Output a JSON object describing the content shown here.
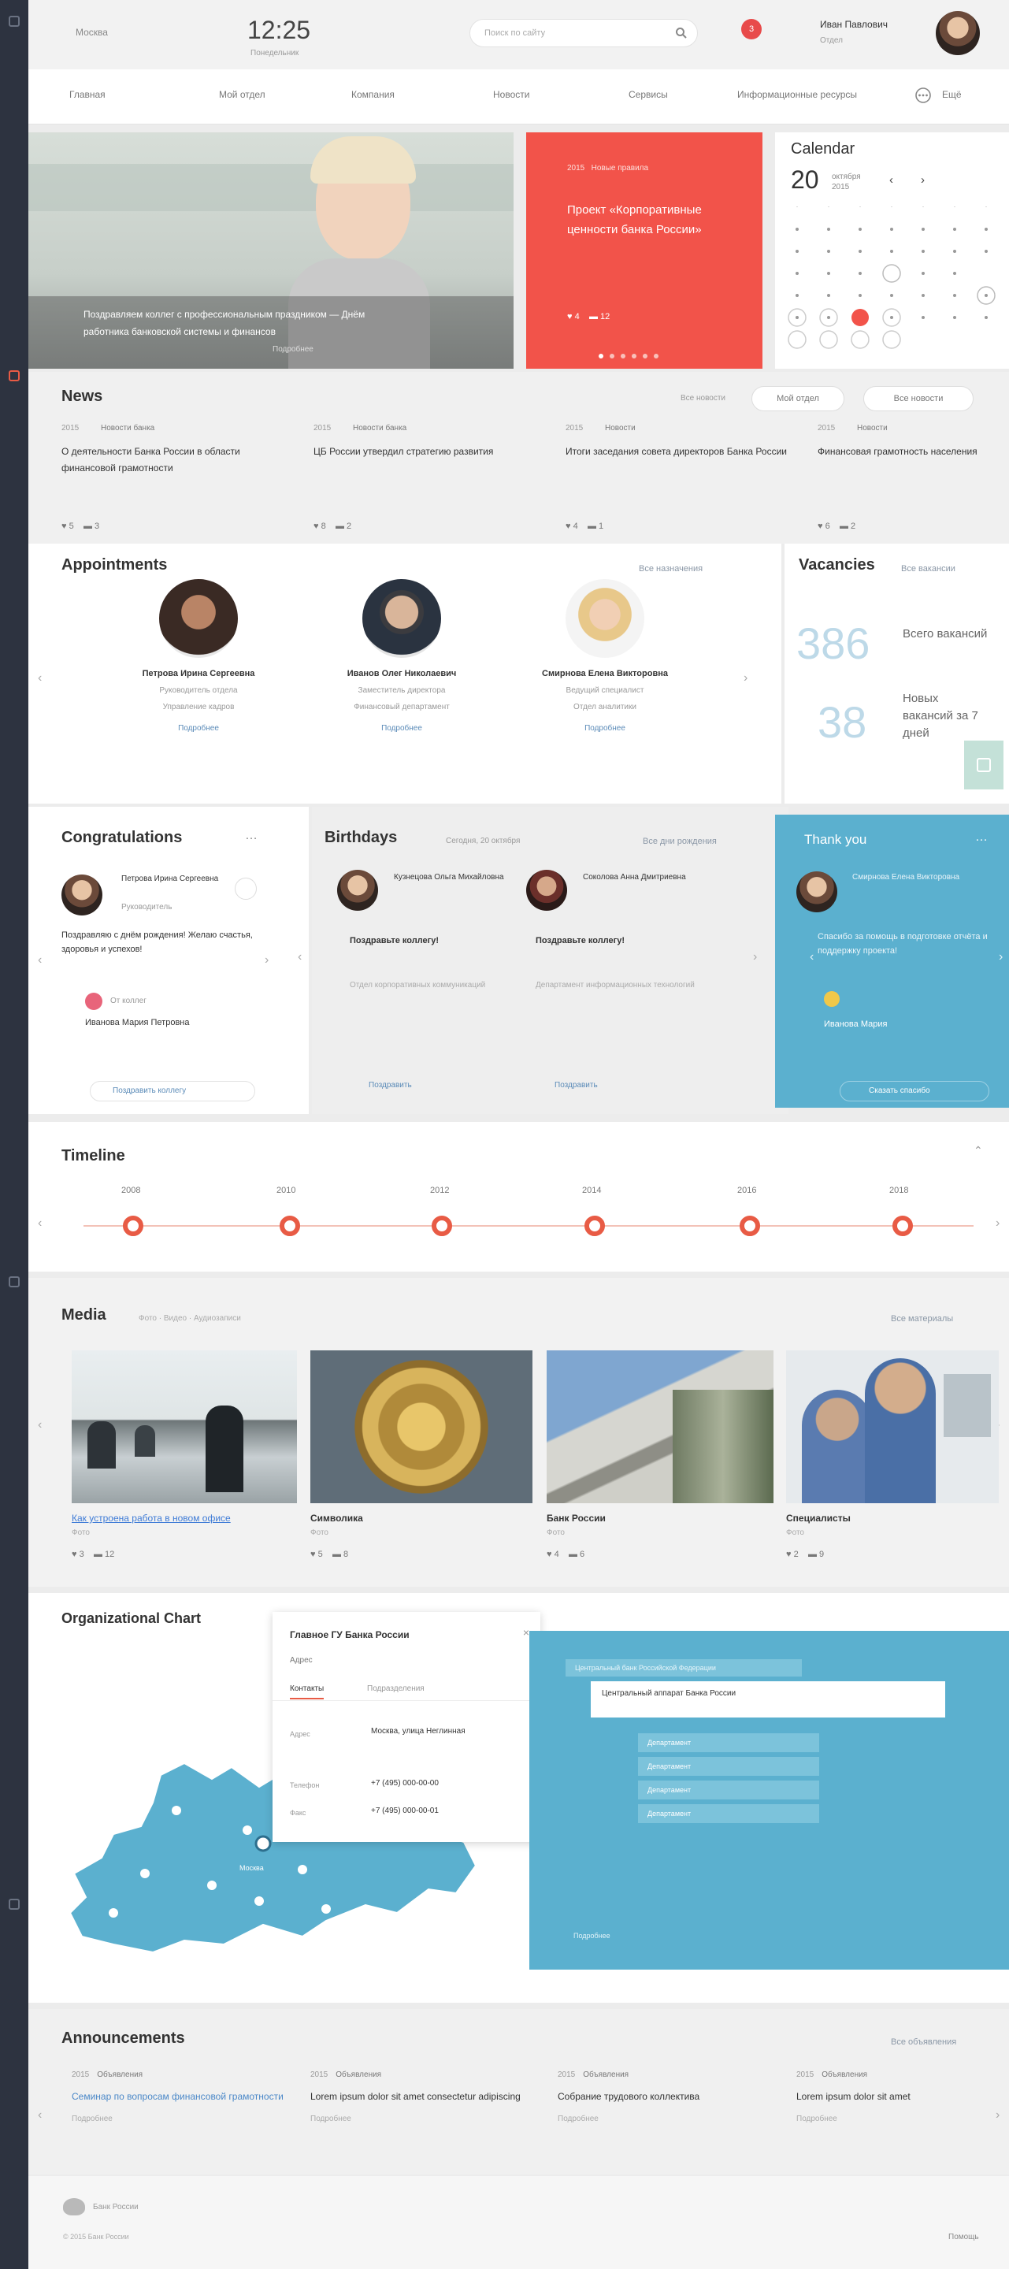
{
  "header": {
    "left_label": "Москва",
    "time": "12:25",
    "date": "Понедельник",
    "search_placeholder": "Поиск по сайту",
    "notif_count": "3",
    "user_name": "Иван Павлович",
    "user_role": "Отдел"
  },
  "nav": {
    "items": [
      "Главная",
      "Мой отдел",
      "Компания",
      "Новости",
      "Сервисы",
      "Информационные ресурсы"
    ],
    "more": "Ещё"
  },
  "hero": {
    "caption_line1": "Поздравляем коллег с профессиональным праздником — Днём",
    "caption_line2": "работника банковской системы и финансов",
    "caption_line3": "Подробнее"
  },
  "promo": {
    "meta_a": "2015",
    "meta_b": "Новые правила",
    "title": "Проект «Корпоративные ценности банка России»",
    "likes": "4",
    "comments": "12"
  },
  "calendar": {
    "title": "Calendar",
    "day": "20",
    "month": "октября 2015"
  },
  "news": {
    "title": "News",
    "filter_label": "Все новости",
    "btn1": "Мой отдел",
    "btn2": "Все новости",
    "items": [
      {
        "date": "2015",
        "tag": "Новости банка",
        "text": "О деятельности Банка России в области финансовой грамотности",
        "likes": "5",
        "comments": "3"
      },
      {
        "date": "2015",
        "tag": "Новости банка",
        "text": "ЦБ России утвердил стратегию развития",
        "likes": "8",
        "comments": "2"
      },
      {
        "date": "2015",
        "tag": "Новости",
        "text": "Итоги заседания совета директоров Банка России",
        "likes": "4",
        "comments": "1"
      },
      {
        "date": "2015",
        "tag": "Новости",
        "text": "Финансовая грамотность населения",
        "likes": "6",
        "comments": "2"
      }
    ]
  },
  "appointments": {
    "title": "Appointments",
    "all_link": "Все назначения",
    "people": [
      {
        "name": "Петрова Ирина Сергеевна",
        "role": "Руководитель отдела",
        "dept": "Управление кадров",
        "link": "Подробнее"
      },
      {
        "name": "Иванов Олег Николаевич",
        "role": "Заместитель директора",
        "dept": "Финансовый департамент",
        "link": "Подробнее"
      },
      {
        "name": "Смирнова Елена Викторовна",
        "role": "Ведущий специалист",
        "dept": "Отдел аналитики",
        "link": "Подробнее"
      }
    ]
  },
  "vacancies": {
    "title": "Vacancies",
    "all_link": "Все вакансии",
    "total_num": "386",
    "total_label": "Всего вакансий",
    "new_num": "38",
    "new_label": "Новых вакансий за 7 дней"
  },
  "congrats": {
    "title": "Congratulations",
    "name": "Петрова Ирина Сергеевна",
    "role": "Руководитель",
    "text": "Поздравляю с днём рождения! Желаю счастья, здоровья и успехов!",
    "from_label": "От коллег",
    "from_name": "Иванова Мария Петровна",
    "link": "Поздравить коллегу"
  },
  "birthdays": {
    "title": "Birthdays",
    "date_label": "Сегодня, 20 октября",
    "all_link": "Все дни рождения",
    "people": [
      {
        "name": "Кузнецова Ольга Михайловна",
        "greeting": "Поздравьте коллегу!",
        "desc": "Отдел корпоративных коммуникаций",
        "link": "Поздравить"
      },
      {
        "name": "Соколова Анна Дмитриевна",
        "greeting": "Поздравьте коллегу!",
        "desc": "Департамент информационных технологий",
        "link": "Поздравить"
      }
    ]
  },
  "thankyou": {
    "title": "Thank you",
    "name": "Смирнова Елена Викторовна",
    "text": "Спасибо за помощь в подготовке отчёта и поддержку проекта!",
    "from": "Иванова Мария",
    "link": "Сказать спасибо"
  },
  "timeline": {
    "title": "Timeline",
    "years": [
      "2008",
      "2010",
      "2012",
      "2014",
      "2016",
      "2018"
    ]
  },
  "media": {
    "title": "Media",
    "tabs": "Фото · Видео · Аудиозаписи",
    "all_link": "Все материалы",
    "items": [
      {
        "caption": "Как устроена работа в новом офисе",
        "sub": "Фото",
        "likes": "3",
        "comments": "12"
      },
      {
        "caption": "Символика",
        "sub": "Фото",
        "likes": "5",
        "comments": "8"
      },
      {
        "caption": "Банк России",
        "sub": "Фото",
        "likes": "4",
        "comments": "6"
      },
      {
        "caption": "Специалисты",
        "sub": "Фото",
        "likes": "2",
        "comments": "9"
      }
    ]
  },
  "org": {
    "title": "Organizational Chart",
    "popup_title": "Главное ГУ Банка России",
    "popup_sub": "Адрес",
    "popup_tab1": "Контакты",
    "popup_tab2": "Подразделения",
    "rows": [
      {
        "k": "Адрес",
        "v": "Москва, улица Неглинная"
      },
      {
        "k": "Телефон",
        "v": "+7 (495) 000-00-00"
      },
      {
        "k": "Факс",
        "v": "+7 (495) 000-00-01"
      }
    ],
    "map_label": "Москва",
    "chart_header": "Центральный банк Российской Федерации",
    "chart_box": "Центральный аппарат Банка России",
    "chart_items": [
      "Департамент",
      "Департамент",
      "Департамент",
      "Департамент"
    ],
    "chart_link": "Подробнее"
  },
  "announcements": {
    "title": "Announcements",
    "all_link": "Все объявления",
    "items": [
      {
        "date": "2015",
        "tag": "Объявления",
        "text": "Семинар по вопросам финансовой грамотности",
        "foot": "Подробнее",
        "blue": true
      },
      {
        "date": "2015",
        "tag": "Объявления",
        "text": "Lorem ipsum dolor sit amet consectetur adipiscing",
        "foot": "Подробнее",
        "blue": false
      },
      {
        "date": "2015",
        "tag": "Объявления",
        "text": "Собрание трудового коллектива",
        "foot": "Подробнее",
        "blue": false
      },
      {
        "date": "2015",
        "tag": "Объявления",
        "text": "Lorem ipsum dolor sit amet",
        "foot": "Подробнее",
        "blue": false
      }
    ]
  },
  "footer": {
    "brand": "Банк России",
    "copyright": "© 2015 Банк России",
    "right": "Помощь"
  }
}
